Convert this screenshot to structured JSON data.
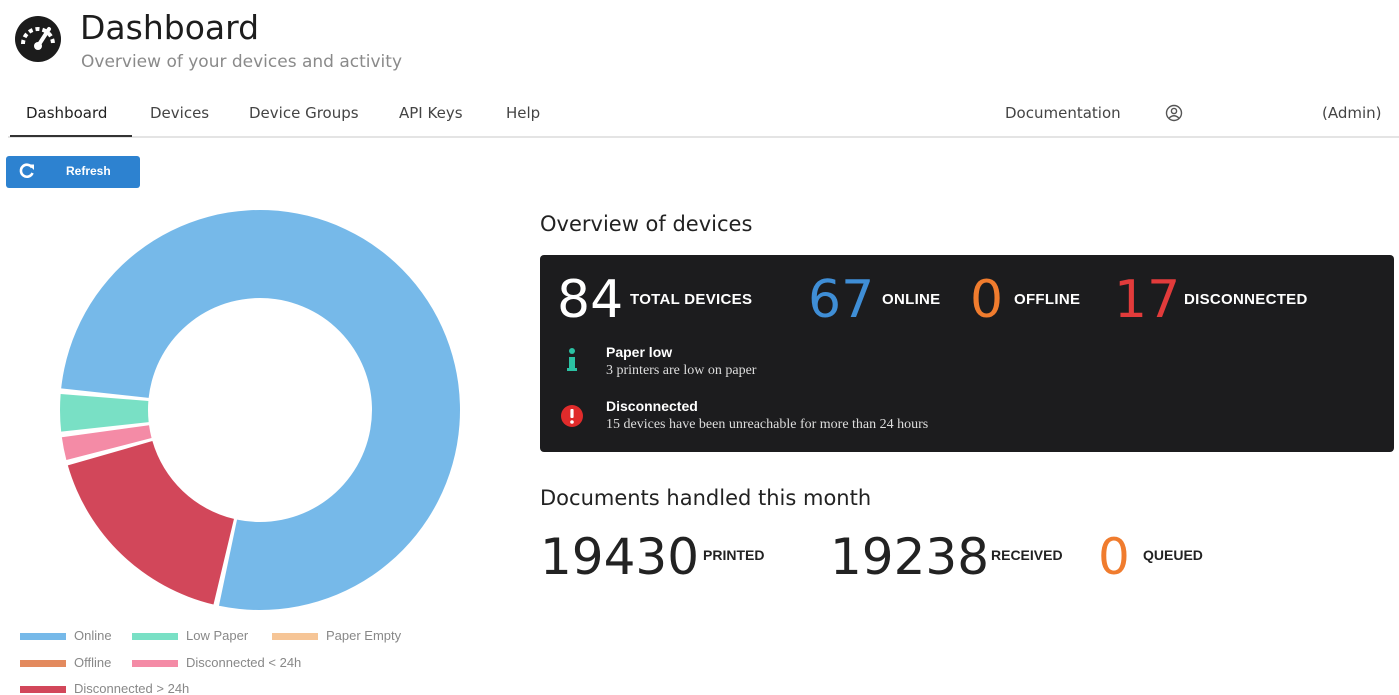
{
  "header": {
    "title": "Dashboard",
    "subtitle": "Overview of your devices and activity",
    "logo_icon": "speedometer-icon"
  },
  "nav": {
    "tabs": [
      {
        "label": "Dashboard",
        "active": true
      },
      {
        "label": "Devices"
      },
      {
        "label": "Device Groups"
      },
      {
        "label": "API Keys"
      },
      {
        "label": "Help"
      }
    ],
    "documentation": "Documentation",
    "user_icon": "user-circle-icon",
    "role": "(Admin)"
  },
  "toolbar": {
    "refresh_label": "Refresh",
    "refresh_icon": "refresh-icon"
  },
  "chart_data": {
    "type": "pie",
    "variant": "donut",
    "categories": [
      "Online",
      "Offline",
      "Disconnected > 24h",
      "Disconnected < 24h",
      "Low Paper",
      "Paper Empty"
    ],
    "values": [
      67,
      0,
      15,
      2,
      3,
      0
    ],
    "colors": [
      "#76b9e9",
      "#e38a5e",
      "#d2475a",
      "#f48ba6",
      "#79e0c5",
      "#f6c596"
    ],
    "legend": [
      "Online",
      "Low Paper",
      "Paper Empty",
      "Offline",
      "Disconnected < 24h",
      "Disconnected > 24h"
    ],
    "legend_position": "bottom-left"
  },
  "overview": {
    "title": "Overview of devices",
    "total": {
      "value": "84",
      "label": "TOTAL DEVICES"
    },
    "online": {
      "value": "67",
      "label": "ONLINE",
      "color": "#3f8ed6"
    },
    "offline": {
      "value": "0",
      "label": "OFFLINE",
      "color": "#f07c2e"
    },
    "disconnected": {
      "value": "17",
      "label": "DISCONNECTED",
      "color": "#e23b3b"
    },
    "alerts": [
      {
        "icon": "info-icon",
        "title": "Paper low",
        "text": "3 printers are low on paper",
        "color": "#2bc1a3"
      },
      {
        "icon": "alert-circle-icon",
        "title": "Disconnected",
        "text": "15 devices have been unreachable for more than 24 hours",
        "color": "#e02b2b"
      }
    ]
  },
  "documents": {
    "title": "Documents handled this month",
    "printed": {
      "value": "19430",
      "label": "PRINTED"
    },
    "received": {
      "value": "19238",
      "label": "RECEIVED"
    },
    "queued": {
      "value": "0",
      "label": "QUEUED",
      "color": "#f07c2e"
    }
  }
}
